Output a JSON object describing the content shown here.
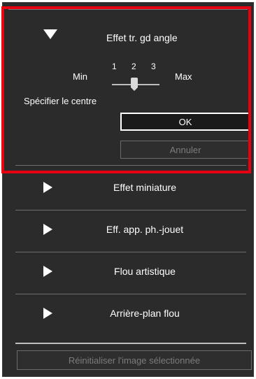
{
  "expanded": {
    "title": "Effet tr. gd angle",
    "slider": {
      "min_label": "Min",
      "max_label": "Max",
      "ticks": [
        "1",
        "2",
        "3"
      ],
      "value": 2
    },
    "specify_label": "Spécifier le centre",
    "ok_label": "OK",
    "cancel_label": "Annuler"
  },
  "collapsed_items": [
    {
      "label": "Effet miniature"
    },
    {
      "label": "Eff. app. ph.-jouet"
    },
    {
      "label": "Flou artistique"
    },
    {
      "label": "Arrière-plan flou"
    }
  ],
  "reset_label": "Réinitialiser l'image sélectionnée",
  "colors": {
    "highlight": "#e60012",
    "panel": "#2b2b2b"
  },
  "icons": {
    "expand": "triangle-right-icon",
    "collapse": "triangle-down-icon"
  }
}
